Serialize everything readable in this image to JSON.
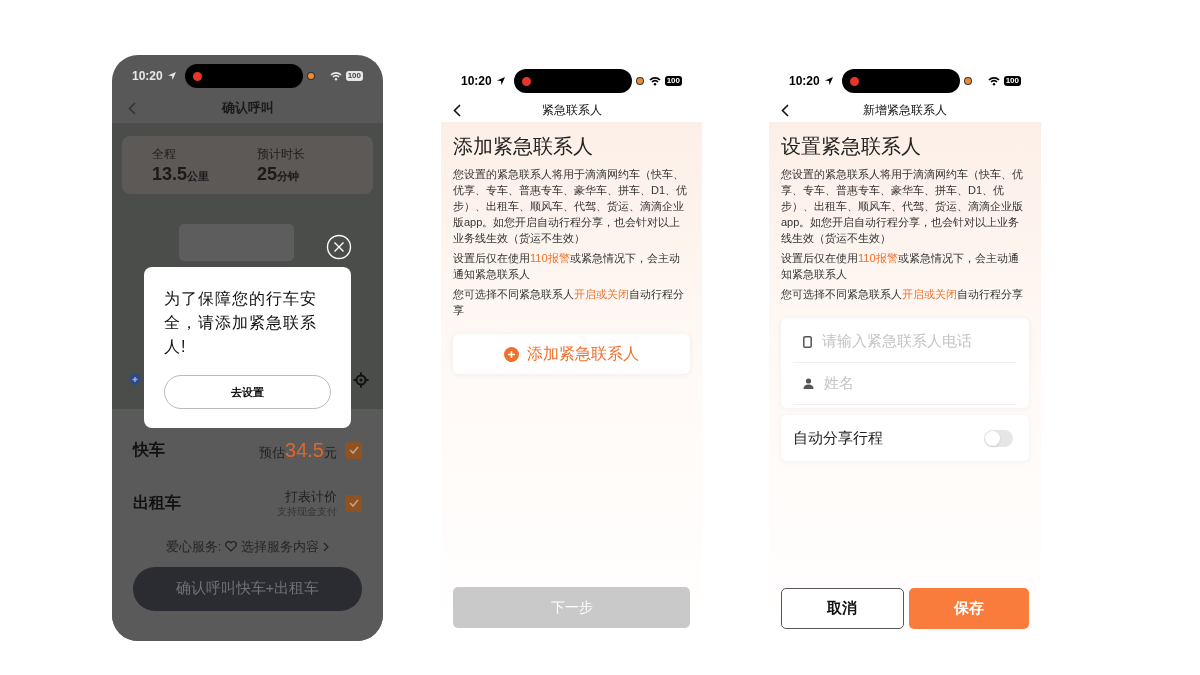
{
  "screens": [
    {
      "status_bar": {
        "time": "10:20",
        "battery": "100"
      },
      "title": "确认呼叫",
      "trip": [
        {
          "label": "全程",
          "value": "13.5",
          "unit": "公里"
        },
        {
          "label": "预计时长",
          "value": "25",
          "unit": "分钟"
        }
      ],
      "dialog": {
        "message": "为了保障您的行车安全，请添加紧急联系人!",
        "button": "去设置"
      },
      "rides": [
        {
          "kind": "price",
          "name": "快车",
          "prefix": "预估",
          "price": "34.5",
          "unit": "元",
          "checked": true
        },
        {
          "kind": "meter",
          "name": "出租车",
          "label": "打表计价",
          "note": "支持现金支付",
          "checked": true
        }
      ],
      "service": {
        "label": "爱心服务:",
        "link": "选择服务内容"
      },
      "confirm_button": "确认呼叫快车+出租车"
    },
    {
      "status_bar": {
        "time": "10:20",
        "battery": "100"
      },
      "title": "紧急联系人",
      "heading": "添加紧急联系人",
      "paragraphs": [
        [
          {
            "text": "您设置的紧急联系人将用于滴滴网约车（快车、优享、专车、普惠专车、豪华车、拼车、D1、优步）、出租车、顺风车、代驾、货运、滴滴企业版app。如您开启自动行程分享，也会针对以上业务线生效（货运不生效）",
            "highlight": false
          }
        ],
        [
          {
            "text": "设置后仅在使用",
            "highlight": false
          },
          {
            "text": "110报警",
            "highlight": true
          },
          {
            "text": "或紧急情况下，会主动通知紧急联系人",
            "highlight": false
          }
        ],
        [
          {
            "text": "您可选择不同紧急联系人",
            "highlight": false
          },
          {
            "text": "开启或关闭",
            "highlight": true
          },
          {
            "text": "自动行程分享",
            "highlight": false
          }
        ]
      ],
      "add_button": "添加紧急联系人",
      "next_button": {
        "label": "下一步",
        "disabled": true
      }
    },
    {
      "status_bar": {
        "time": "10:20",
        "battery": "100"
      },
      "title": "新增紧急联系人",
      "heading": "设置紧急联系人",
      "paragraphs": [
        [
          {
            "text": "您设置的紧急联系人将用于滴滴网约车（快车、优享、专车、普惠专车、豪华车、拼车、D1、优步）、出租车、顺风车、代驾、货运、滴滴企业版app。如您开启自动行程分享，也会针对以上业务线生效（货运不生效）",
            "highlight": false
          }
        ],
        [
          {
            "text": "设置后仅在使用",
            "highlight": false
          },
          {
            "text": "110报警",
            "highlight": true
          },
          {
            "text": "或紧急情况下，会主动通知紧急联系人",
            "highlight": false
          }
        ],
        [
          {
            "text": "您可选择不同紧急联系人",
            "highlight": false
          },
          {
            "text": "开启或关闭",
            "highlight": true
          },
          {
            "text": "自动行程分享",
            "highlight": false
          }
        ]
      ],
      "fields": [
        {
          "kind": "phone",
          "placeholder": "请输入紧急联系人电话"
        },
        {
          "kind": "person",
          "placeholder": "姓名"
        }
      ],
      "toggle": {
        "label": "自动分享行程",
        "on": false
      },
      "buttons": [
        {
          "kind": "secondary",
          "label": "取消"
        },
        {
          "kind": "primary",
          "label": "保存"
        }
      ]
    }
  ]
}
